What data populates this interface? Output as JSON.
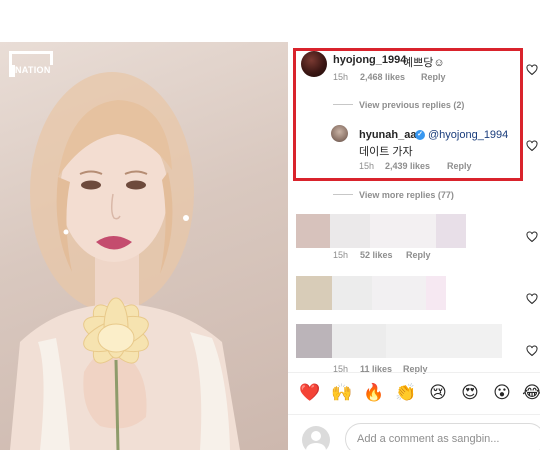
{
  "brand": {
    "logo_text": "NATION"
  },
  "comments": [
    {
      "username": "hyojong_1994",
      "text": "예쁘당☺",
      "age": "15h",
      "likes": "2,468 likes",
      "reply_label": "Reply"
    }
  ],
  "thread": {
    "view_previous": "View previous replies (2)",
    "view_more": "View more replies (77)"
  },
  "reply": {
    "username": "hyunah_aa",
    "verified_mark": "✓",
    "mention": "@hyojong_1994",
    "text": "데이트 가자",
    "age": "15h",
    "likes": "2,439 likes",
    "reply_label": "Reply"
  },
  "blurred_comments": [
    {
      "age": "15h",
      "likes": "52 likes",
      "reply_label": "Reply"
    },
    {
      "age": "15h",
      "likes": "11 likes",
      "reply_label": "Reply"
    }
  ],
  "emoji_bar": [
    "❤️",
    "🙌",
    "🔥",
    "👏",
    "😢",
    "😍",
    "😮",
    "😂"
  ],
  "input": {
    "placeholder": "Add a comment as sangbin..."
  },
  "colors": {
    "highlight": "#d9232c",
    "verified": "#3897f0",
    "mention": "#1a3d7c",
    "muted": "#8e8e8e"
  }
}
